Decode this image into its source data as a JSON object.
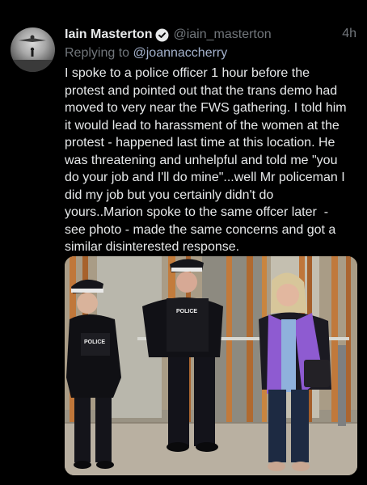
{
  "tweet": {
    "author_name": "Iain Masterton",
    "author_handle": "@iain_masterton",
    "timestamp": "4h",
    "reply_prefix": "Replying to ",
    "reply_to": "@joannaccherry",
    "text": "I spoke to a police officer 1 hour before the\nprotest and pointed out that the trans demo had\nmoved to very near the FWS gathering. I told him\nit would lead to harassment of the women at the\nprotest - happened last time at this location. He\nwas threatening and unhelpful and told me \"you\ndo your job and I'll do mine\"...well Mr policeman I\ndid my job but you certainly didn't do\nyours..Marion spoke to the same offcer later  -\nsee photo - made the same concerns and got a\nsimilar disinterested response."
  },
  "photo": {
    "vest_labels": [
      "POLICE",
      "POLICE"
    ]
  },
  "icons": {
    "verified": "verified-badge-icon"
  },
  "colors": {
    "background": "#000000",
    "text": "#e7e9ea",
    "secondary": "#71767b",
    "mention": "#a4b2cc",
    "hi_vis_purple": "#8e5bd1"
  }
}
